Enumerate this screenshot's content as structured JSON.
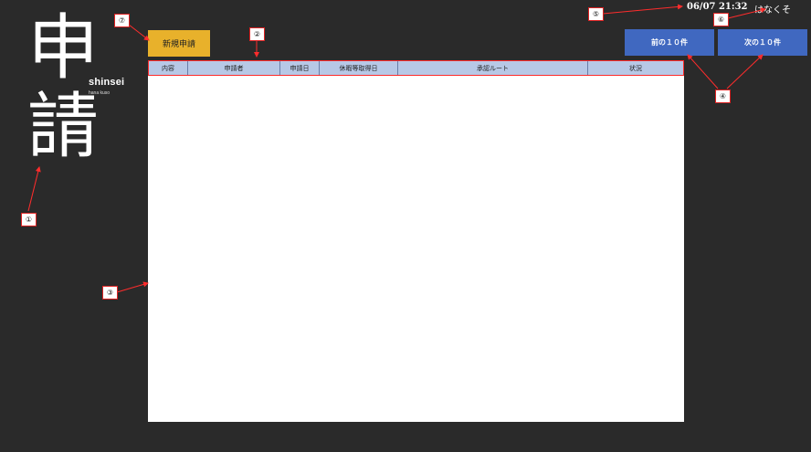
{
  "logo": {
    "char1": "申",
    "char2": "請",
    "romaji": "shinsei",
    "sub": "hana kuso"
  },
  "header": {
    "new_button": "新規申請",
    "datetime": "06/07 21:32",
    "username": "はなくそ",
    "prev_button": "前の１０件",
    "next_button": "次の１０件"
  },
  "table": {
    "columns": [
      "内容",
      "申請者",
      "申請日",
      "休暇等取得日",
      "承認ルート",
      "状況"
    ],
    "rows": []
  },
  "annotations": {
    "m1": "①",
    "m2": "②",
    "m3": "③",
    "m4": "④",
    "m5": "⑤",
    "m6": "⑥",
    "m7": "⑦"
  },
  "colors": {
    "background": "#2a2a2a",
    "new_button": "#e8b12b",
    "nav_button": "#4068c0",
    "table_header": "#b7c8e6",
    "annotation": "#ff2c2c"
  }
}
